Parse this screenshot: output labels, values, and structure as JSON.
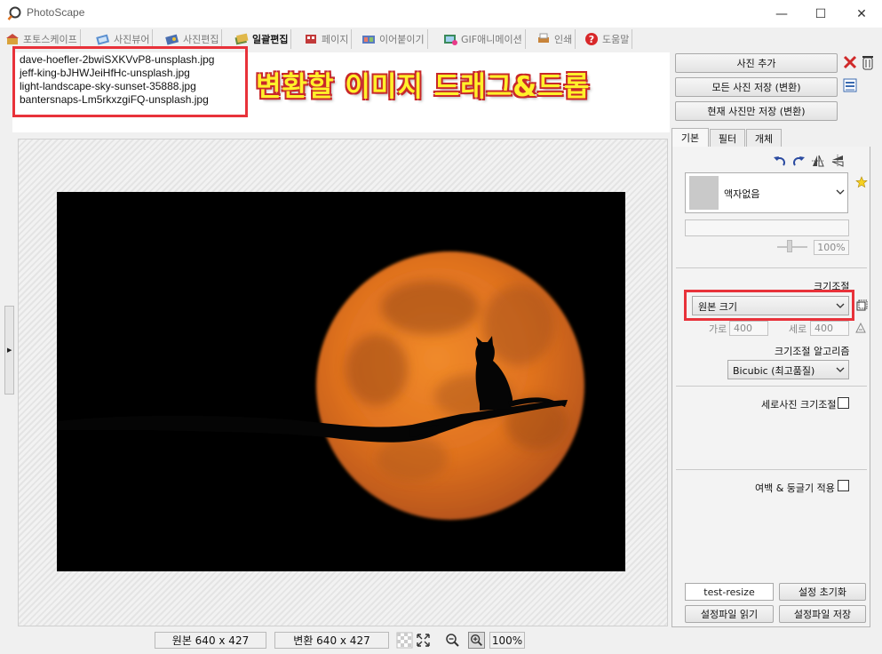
{
  "window": {
    "title": "PhotoScape",
    "minimize_glyph": "—",
    "maximize_glyph": "☐",
    "close_glyph": "✕"
  },
  "tabs": [
    {
      "label": "포토스케이프",
      "icon": "photoscape-home-icon",
      "active": false
    },
    {
      "label": "사진뷰어",
      "icon": "photo-viewer-icon",
      "active": false
    },
    {
      "label": "사진편집",
      "icon": "photo-edit-icon",
      "active": false
    },
    {
      "label": "일괄편집",
      "icon": "batch-edit-icon",
      "active": true
    },
    {
      "label": "페이지",
      "icon": "page-icon",
      "active": false
    },
    {
      "label": "이어붙이기",
      "icon": "combine-icon",
      "active": false
    },
    {
      "label": "GIF애니메이션",
      "icon": "gif-animation-icon",
      "active": false
    },
    {
      "label": "인쇄",
      "icon": "print-icon",
      "active": false
    },
    {
      "label": "도움말",
      "icon": "help-icon",
      "active": false
    }
  ],
  "file_list": {
    "files": [
      "dave-hoefler-2bwiSXKVvP8-unsplash.jpg",
      "jeff-king-bJHWJeiHfHc-unsplash.jpg",
      "light-landscape-sky-sunset-35888.jpg",
      "bantersnaps-Lm5rkxzgiFQ-unsplash.jpg"
    ],
    "annotation": "변환할 이미지 드래그&드롭"
  },
  "status_bar": {
    "original_size": "원본 640 x 427",
    "converted_size": "변환 640 x 427",
    "zoom": "100%"
  },
  "right_panel": {
    "add_photo": "사진 추가",
    "save_all": "모든 사진 저장 (변환)",
    "save_current": "현재 사진만 저장 (변환)",
    "tabs": [
      "기본",
      "필터",
      "개체"
    ],
    "frame": {
      "selected": "액자없음",
      "percent": "100%"
    },
    "resize": {
      "section_label": "크기조절",
      "selected": "원본 크기",
      "width_label": "가로",
      "width_value": "400",
      "height_label": "세로",
      "height_value": "400",
      "algorithm_label": "크기조절 알고리즘",
      "algorithm_selected": "Bicubic (최고품질)"
    },
    "portrait_resize_label": "세로사진 크기조절",
    "margin_round_label": "여백 & 둥글기 적용",
    "preset_name": "test-resize",
    "reset_settings": "설정 초기화",
    "load_settings": "설정파일 읽기",
    "save_settings": "설정파일 저장"
  },
  "colors": {
    "highlight_red": "#e8323a",
    "annotation_yellow": "#fff12a",
    "moon_orange": "#e0721f"
  }
}
